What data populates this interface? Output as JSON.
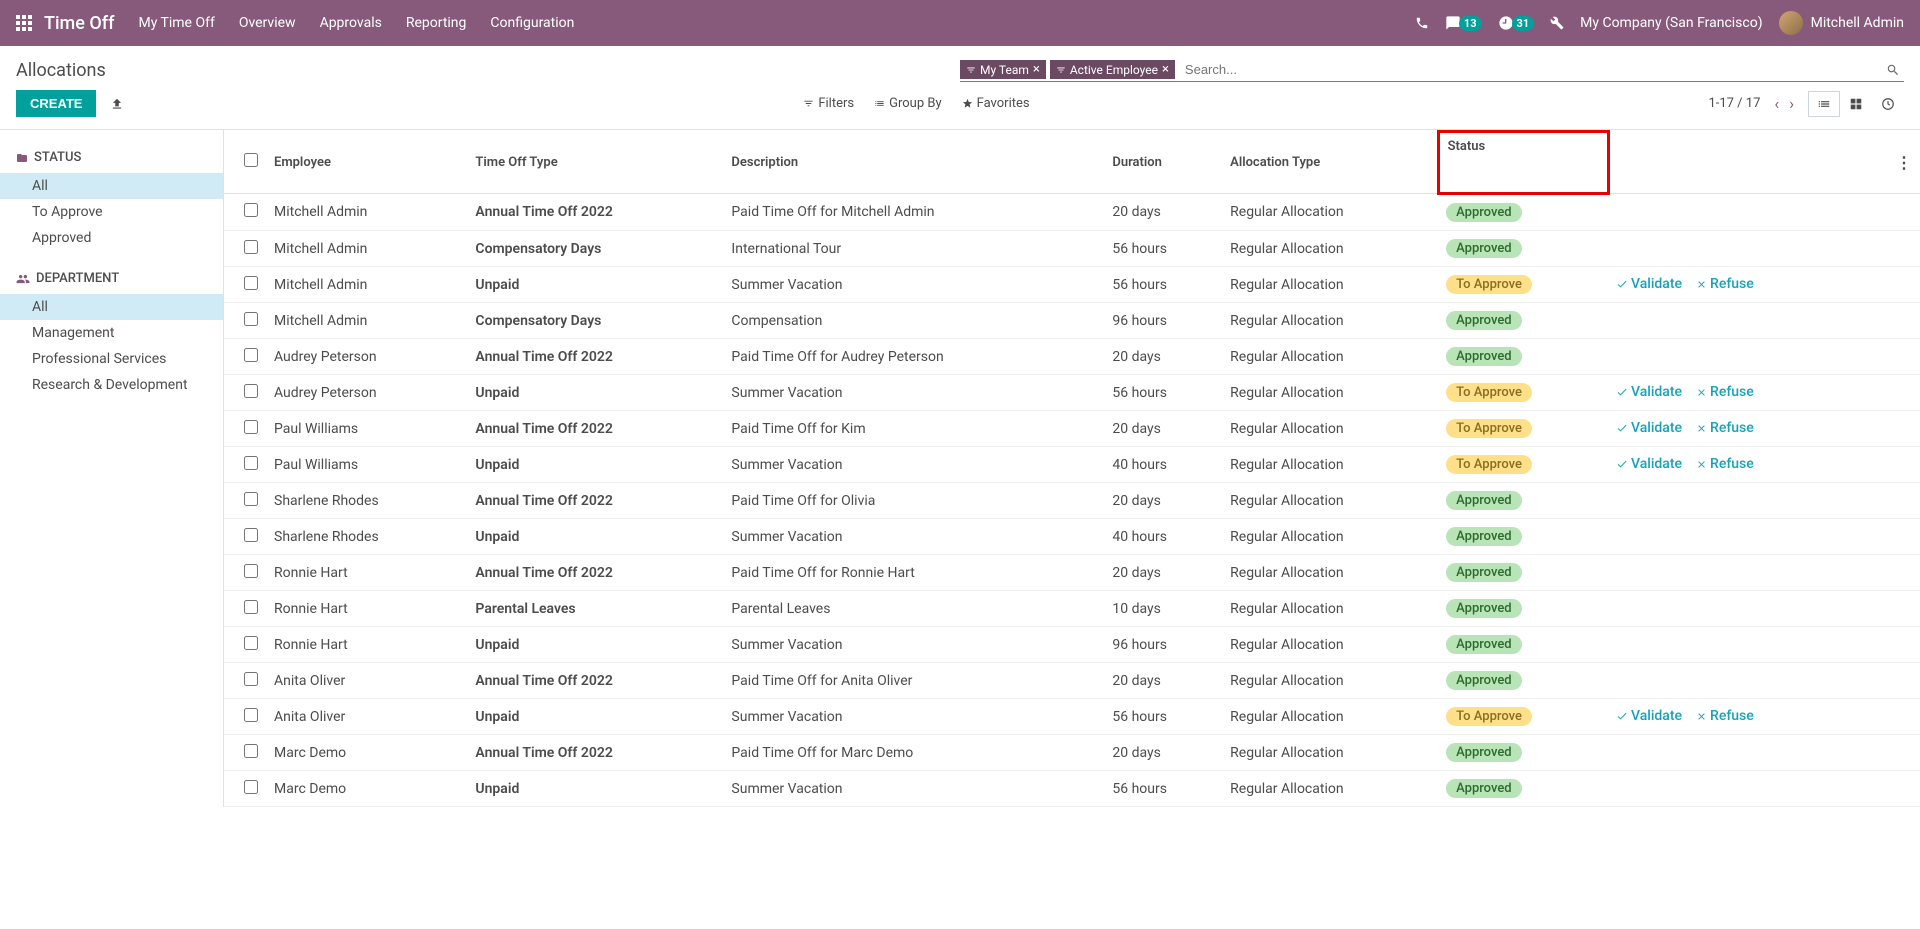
{
  "topnav": {
    "brand": "Time Off",
    "menu": [
      "My Time Off",
      "Overview",
      "Approvals",
      "Reporting",
      "Configuration"
    ],
    "msg_count": "13",
    "activity_count": "31",
    "company": "My Company (San Francisco)",
    "user": "Mitchell Admin"
  },
  "control_panel": {
    "title": "Allocations",
    "create": "CREATE",
    "filter_tags": [
      "My Team",
      "Active Employee"
    ],
    "search_placeholder": "Search...",
    "filters": "Filters",
    "group_by": "Group By",
    "favorites": "Favorites",
    "pager": "1-17 / 17"
  },
  "sidebar": {
    "status_label": "STATUS",
    "status_items": [
      "All",
      "To Approve",
      "Approved"
    ],
    "dept_label": "DEPARTMENT",
    "dept_items": [
      "All",
      "Management",
      "Professional Services",
      "Research & Development"
    ]
  },
  "table": {
    "headers": {
      "employee": "Employee",
      "type": "Time Off Type",
      "description": "Description",
      "duration": "Duration",
      "allocation": "Allocation Type",
      "status": "Status"
    },
    "validate": "Validate",
    "refuse": "Refuse",
    "rows": [
      {
        "employee": "Mitchell Admin",
        "type": "Annual Time Off 2022",
        "desc": "Paid Time Off for Mitchell Admin",
        "duration": "20 days",
        "alloc": "Regular Allocation",
        "status": "Approved",
        "actions": false
      },
      {
        "employee": "Mitchell Admin",
        "type": "Compensatory Days",
        "desc": "International Tour",
        "duration": "56 hours",
        "alloc": "Regular Allocation",
        "status": "Approved",
        "actions": false
      },
      {
        "employee": "Mitchell Admin",
        "type": "Unpaid",
        "desc": "Summer Vacation",
        "duration": "56 hours",
        "alloc": "Regular Allocation",
        "status": "To Approve",
        "actions": true
      },
      {
        "employee": "Mitchell Admin",
        "type": "Compensatory Days",
        "desc": "Compensation",
        "duration": "96 hours",
        "alloc": "Regular Allocation",
        "status": "Approved",
        "actions": false
      },
      {
        "employee": "Audrey Peterson",
        "type": "Annual Time Off 2022",
        "desc": "Paid Time Off for Audrey Peterson",
        "duration": "20 days",
        "alloc": "Regular Allocation",
        "status": "Approved",
        "actions": false
      },
      {
        "employee": "Audrey Peterson",
        "type": "Unpaid",
        "desc": "Summer Vacation",
        "duration": "56 hours",
        "alloc": "Regular Allocation",
        "status": "To Approve",
        "actions": true
      },
      {
        "employee": "Paul Williams",
        "type": "Annual Time Off 2022",
        "desc": "Paid Time Off for Kim",
        "duration": "20 days",
        "alloc": "Regular Allocation",
        "status": "To Approve",
        "actions": true
      },
      {
        "employee": "Paul Williams",
        "type": "Unpaid",
        "desc": "Summer Vacation",
        "duration": "40 hours",
        "alloc": "Regular Allocation",
        "status": "To Approve",
        "actions": true
      },
      {
        "employee": "Sharlene Rhodes",
        "type": "Annual Time Off 2022",
        "desc": "Paid Time Off for Olivia",
        "duration": "20 days",
        "alloc": "Regular Allocation",
        "status": "Approved",
        "actions": false
      },
      {
        "employee": "Sharlene Rhodes",
        "type": "Unpaid",
        "desc": "Summer Vacation",
        "duration": "40 hours",
        "alloc": "Regular Allocation",
        "status": "Approved",
        "actions": false
      },
      {
        "employee": "Ronnie Hart",
        "type": "Annual Time Off 2022",
        "desc": "Paid Time Off for Ronnie Hart",
        "duration": "20 days",
        "alloc": "Regular Allocation",
        "status": "Approved",
        "actions": false
      },
      {
        "employee": "Ronnie Hart",
        "type": "Parental Leaves",
        "desc": "Parental Leaves",
        "duration": "10 days",
        "alloc": "Regular Allocation",
        "status": "Approved",
        "actions": false
      },
      {
        "employee": "Ronnie Hart",
        "type": "Unpaid",
        "desc": "Summer Vacation",
        "duration": "96 hours",
        "alloc": "Regular Allocation",
        "status": "Approved",
        "actions": false
      },
      {
        "employee": "Anita Oliver",
        "type": "Annual Time Off 2022",
        "desc": "Paid Time Off for Anita Oliver",
        "duration": "20 days",
        "alloc": "Regular Allocation",
        "status": "Approved",
        "actions": false
      },
      {
        "employee": "Anita Oliver",
        "type": "Unpaid",
        "desc": "Summer Vacation",
        "duration": "56 hours",
        "alloc": "Regular Allocation",
        "status": "To Approve",
        "actions": true
      },
      {
        "employee": "Marc Demo",
        "type": "Annual Time Off 2022",
        "desc": "Paid Time Off for Marc Demo",
        "duration": "20 days",
        "alloc": "Regular Allocation",
        "status": "Approved",
        "actions": false
      },
      {
        "employee": "Marc Demo",
        "type": "Unpaid",
        "desc": "Summer Vacation",
        "duration": "56 hours",
        "alloc": "Regular Allocation",
        "status": "Approved",
        "actions": false
      }
    ]
  }
}
